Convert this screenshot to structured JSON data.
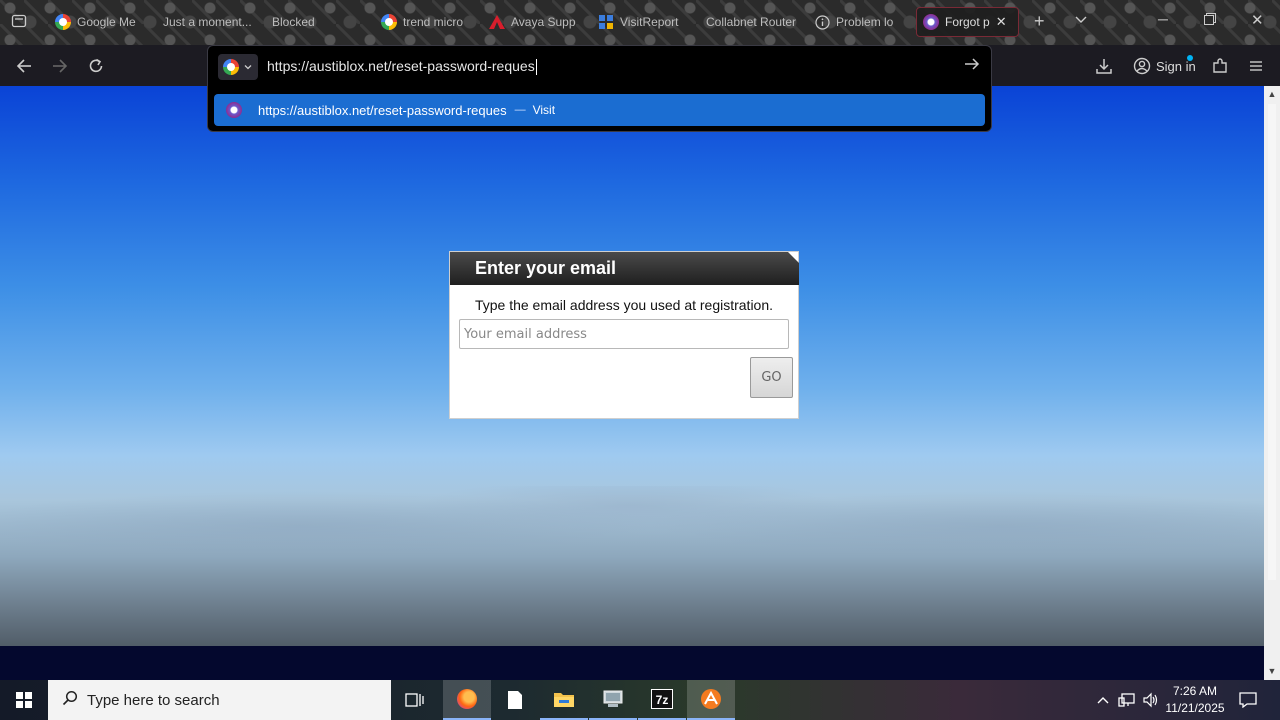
{
  "tabs": [
    {
      "label": "Google Me",
      "icon": "google-icon"
    },
    {
      "label": "Just a moment...",
      "icon": "none"
    },
    {
      "label": "Blocked",
      "icon": "none"
    },
    {
      "label": "trend micro",
      "icon": "google-icon"
    },
    {
      "label": "Avaya Supp",
      "icon": "avaya-icon"
    },
    {
      "label": "VisitReport",
      "icon": "app-icon"
    },
    {
      "label": "Collabnet Router",
      "icon": "none"
    },
    {
      "label": "Problem lo",
      "icon": "info-icon"
    },
    {
      "label": "Forgot p",
      "icon": "site-icon",
      "active": true
    }
  ],
  "nav": {
    "signin_label": "Sign in"
  },
  "urlbar": {
    "value": "https://austiblox.net/reset-password-reques",
    "suggestion_url": "https://austiblox.net/reset-password-reques",
    "suggestion_separator": "—",
    "suggestion_action": "Visit"
  },
  "card": {
    "title": "Enter your email",
    "description": "Type the email address you used at registration.",
    "email_placeholder": "Your email address",
    "go_label": "GO"
  },
  "taskbar": {
    "search_placeholder": "Type here to search",
    "time": "7:26 AM",
    "date": "11/21/2025"
  }
}
